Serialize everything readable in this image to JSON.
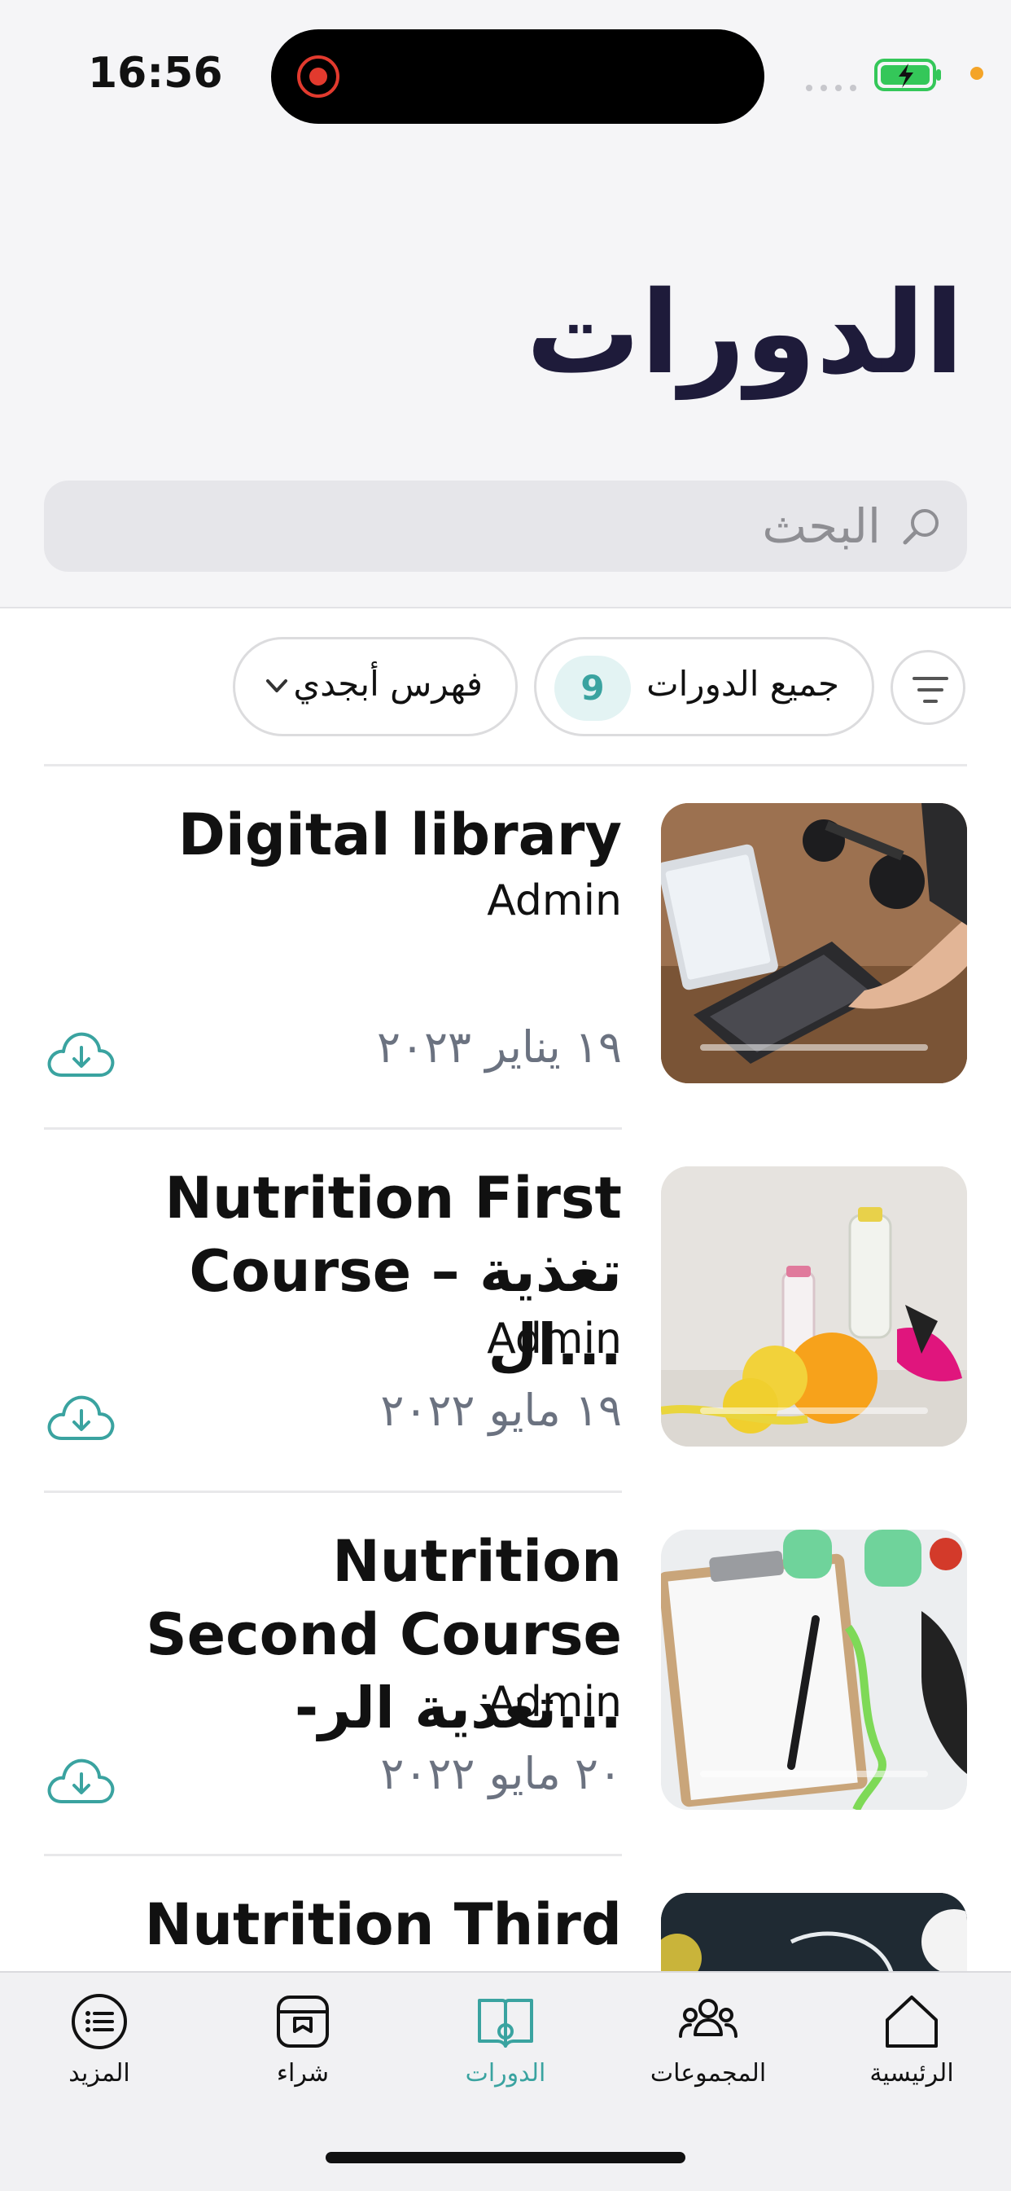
{
  "status_bar": {
    "time": "16:56"
  },
  "page": {
    "title": "الدورات"
  },
  "search": {
    "placeholder": "البحث"
  },
  "filters": {
    "all_courses_label": "جميع الدورات",
    "all_courses_count": "9",
    "sort_label": "فهرس أبجدي"
  },
  "courses": [
    {
      "title": "Digital library",
      "author": "Admin",
      "date": "١٩ يناير ٢٠٢٣"
    },
    {
      "title": "Nutrition First Course – تغذية ال...",
      "author": "Admin",
      "date": "١٩ مايو ٢٠٢٢"
    },
    {
      "title": "Nutrition Second Course -تغذية الر...",
      "author": "Admin",
      "date": "٢٠ مايو ٢٠٢٢"
    },
    {
      "title": "Nutrition Third"
    }
  ],
  "tabbar": {
    "items": [
      {
        "label": "المزيد",
        "icon": "list-icon"
      },
      {
        "label": "شراء",
        "icon": "store-icon"
      },
      {
        "label": "الدورات",
        "icon": "book-icon"
      },
      {
        "label": "المجموعات",
        "icon": "people-icon"
      },
      {
        "label": "الرئيسية",
        "icon": "house-icon"
      }
    ],
    "active": "الدورات"
  },
  "colors": {
    "accent": "#3aa3a0",
    "title": "#1e1b3a",
    "date": "#6b7280",
    "background_top": "#f5f5f7"
  }
}
